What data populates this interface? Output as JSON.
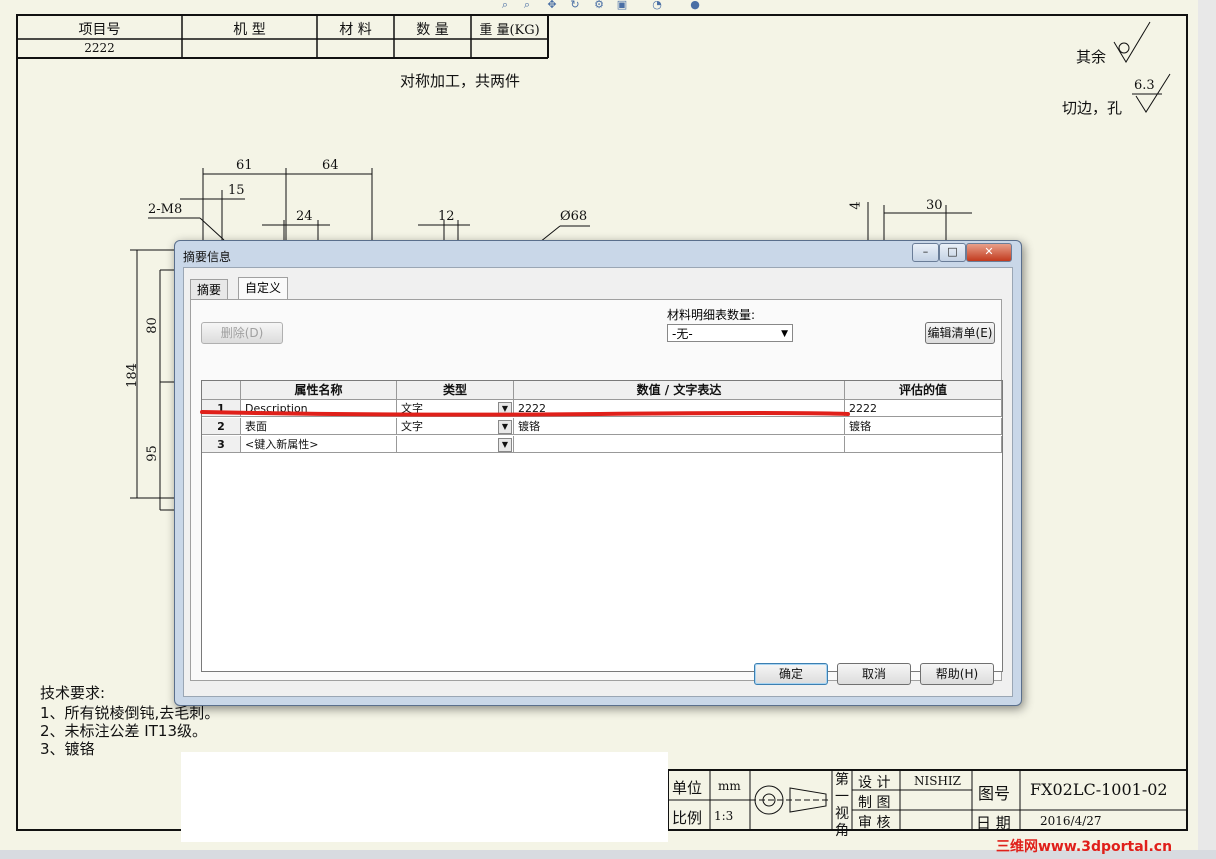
{
  "toolbar": {
    "icons": [
      "zoom-fit-icon",
      "zoom-area-icon",
      "pan-icon",
      "rotate-icon",
      "settings-icon",
      "display-icon",
      "view-icon",
      "render-icon"
    ]
  },
  "title_header": {
    "headers": [
      "项目号",
      "机  型",
      "材 料",
      "数 量",
      "重 量(KG)"
    ],
    "project_no": "2222"
  },
  "drawing": {
    "machining_note": "对称加工，共两件",
    "roughness_rest": "其余",
    "roughness_edge": "切边，孔",
    "roughness_value": "6.3",
    "dims": {
      "d61": "61",
      "d64": "64",
      "d15": "15",
      "thread": "2-M8",
      "d24": "24",
      "d12": "12",
      "dia68": "Ø68",
      "d4": "4",
      "d30": "30",
      "d80": "80",
      "d184": "184",
      "d95": "95"
    },
    "tech_title": "技术要求:",
    "tech_items": [
      "1、所有锐棱倒钝,去毛刺。",
      "2、未标注公差 IT13级。",
      "3、镀铬"
    ]
  },
  "title_block": {
    "unit_label": "单位",
    "unit_value": "mm",
    "scale_label": "比例",
    "scale_value": "1:3",
    "angle_label": "第一视角",
    "design_label": "设 计",
    "designer": "NISHIZ",
    "draw_label": "制 图",
    "check_label": "审 核",
    "drawing_no_label": "图号",
    "drawing_no": "FX02LC-1001-02",
    "date_label": "日 期",
    "date": "2016/4/27"
  },
  "watermark": "三维网www.3dportal.cn",
  "dialog": {
    "title": "摘要信息",
    "window_buttons": {
      "minimize": "–",
      "maximize": "□",
      "close": "✕"
    },
    "tabs": [
      "摘要",
      "自定义"
    ],
    "active_tab": "自定义",
    "delete_button": "删除(D)",
    "bom_qty_label": "材料明细表数量:",
    "bom_qty_value": "-无-",
    "edit_list_button": "编辑清单(E)",
    "grid": {
      "columns": [
        "属性名称",
        "类型",
        "数值 / 文字表达",
        "评估的值"
      ],
      "rows": [
        {
          "num": "1",
          "name": "Description",
          "type": "文字",
          "value": "2222",
          "evaluated": "2222"
        },
        {
          "num": "2",
          "name": "表面",
          "type": "文字",
          "value": "镀铬",
          "evaluated": "镀铬"
        },
        {
          "num": "3",
          "name": "<键入新属性>",
          "type": "",
          "value": "",
          "evaluated": ""
        }
      ]
    },
    "ok_button": "确定",
    "cancel_button": "取消",
    "help_button": "帮助(H)"
  },
  "colors": {
    "annotation_red": "#e0201a",
    "dialog_frame": "#c9d7e8"
  }
}
